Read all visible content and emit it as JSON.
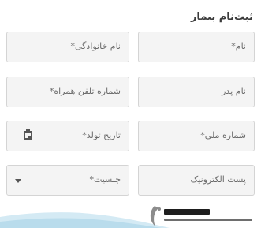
{
  "form": {
    "title": "ثبت‌نام بیمار",
    "fields": {
      "first_name": "نام*",
      "last_name": "نام خانوادگی*",
      "father_name": "نام پدر",
      "phone": "شماره تلفن همراه*",
      "national_id": "شماره ملی*",
      "birth_date": "تاریخ تولد*",
      "email": "پست الکترونیک",
      "gender": "جنسیت*"
    }
  },
  "icons": {
    "calendar": "calendar-icon",
    "dropdown": "caret-down-icon"
  },
  "colors": {
    "field_background": "#f4f4f4",
    "field_border": "#d4d4d4",
    "wave": "#b9dcec"
  }
}
